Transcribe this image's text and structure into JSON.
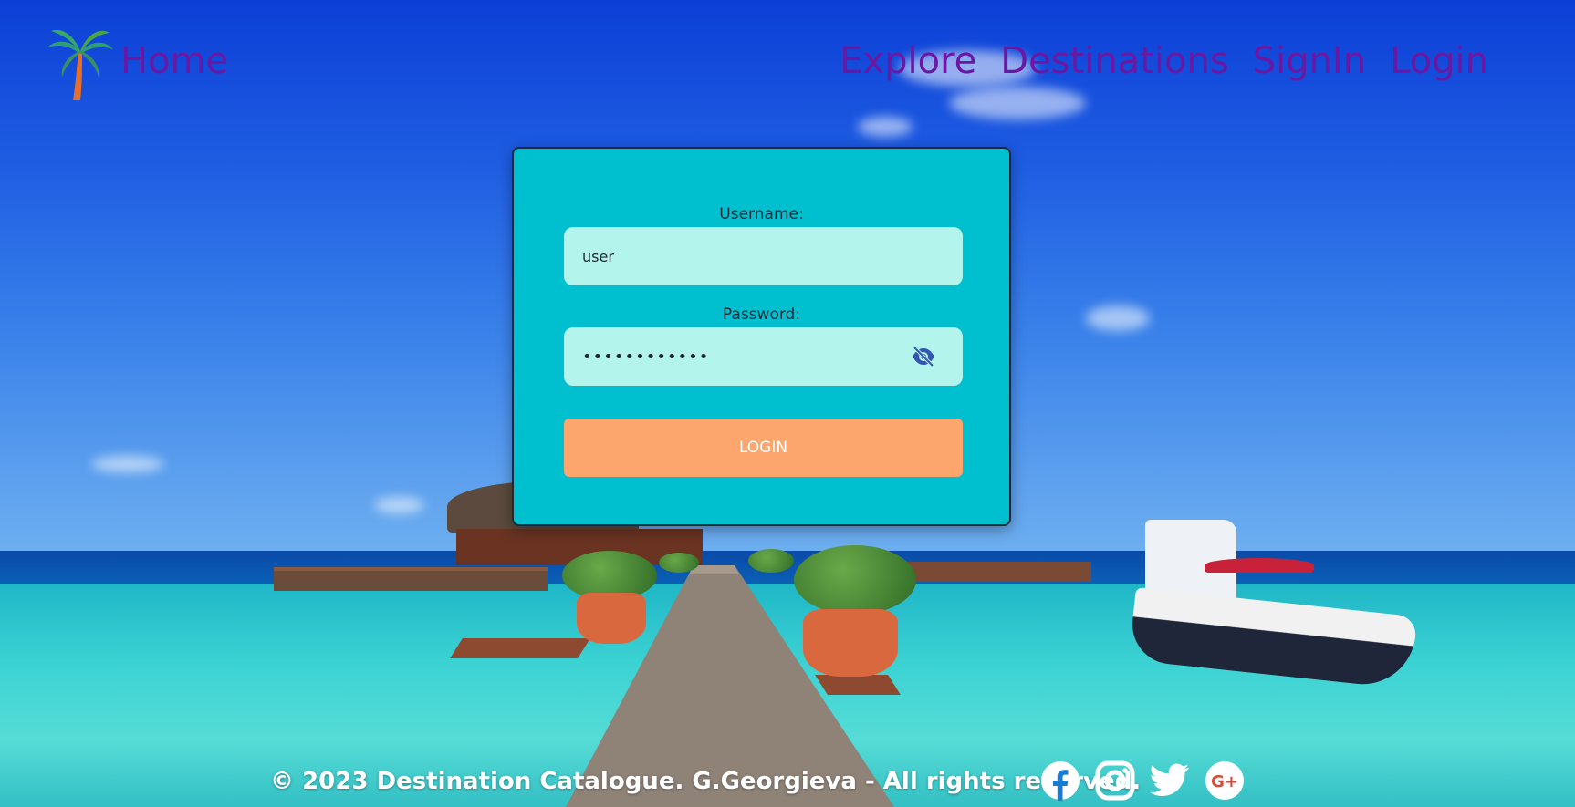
{
  "header": {
    "home_label": "Home",
    "nav": [
      "Explore",
      "Destinations",
      "SignIn",
      "Login"
    ]
  },
  "login_form": {
    "username_label": "Username:",
    "username_value": "user",
    "password_label": "Password:",
    "password_value": "••••••••••••",
    "submit_label": "LOGIN"
  },
  "footer": {
    "copyright": "© 2023 Destination Catalogue. G.Georgieva - All rights reserved.",
    "social_icons": [
      "facebook-icon",
      "instagram-icon",
      "twitter-icon",
      "google-plus-icon"
    ]
  },
  "colors": {
    "nav_text": "#6a18a3",
    "card_bg": "#00bfcf",
    "input_bg": "#b3f4ec",
    "button_bg": "#fca56c"
  }
}
